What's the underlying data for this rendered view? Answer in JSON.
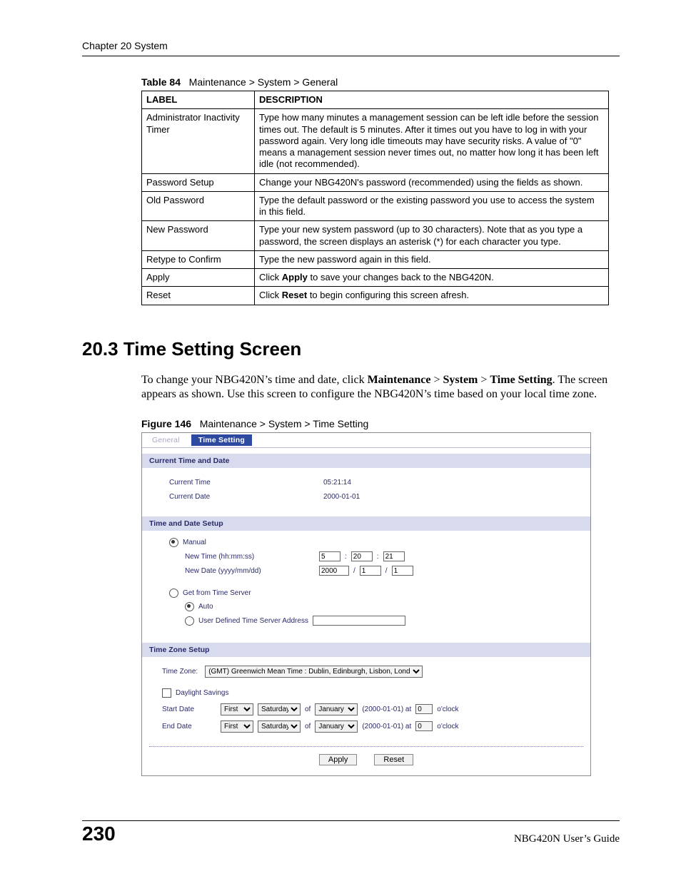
{
  "header": {
    "chapter": "Chapter 20 System"
  },
  "table": {
    "caption_num": "Table 84",
    "caption_text": "Maintenance > System > General",
    "col1": "LABEL",
    "col2": "DESCRIPTION",
    "rows": [
      {
        "label": "Administrator Inactivity Timer",
        "desc": "Type how many minutes a management session can be left idle before the session times out. The default is 5 minutes. After it times out you have to log in with your password again. Very long idle timeouts may have security risks. A value of \"0\" means a management session never times out, no matter how long it has been left idle (not recommended)."
      },
      {
        "label": "Password Setup",
        "desc": "Change your NBG420N's password (recommended) using the fields as shown."
      },
      {
        "label": "Old Password",
        "desc": "Type the default password or the existing password you use to access the system in this field."
      },
      {
        "label": "New Password",
        "desc": "Type your new system password (up to 30 characters). Note that as you type a password, the screen displays an asterisk (*) for each character you type."
      },
      {
        "label": "Retype to Confirm",
        "desc": "Type the new password again in this field."
      },
      {
        "label": "Apply",
        "desc_pre": "Click ",
        "desc_bold": "Apply",
        "desc_post": " to save your changes back to the NBG420N."
      },
      {
        "label": "Reset",
        "desc_pre": "Click ",
        "desc_bold": "Reset",
        "desc_post": " to begin configuring this screen afresh."
      }
    ]
  },
  "section": {
    "heading": "20.3  Time Setting Screen",
    "p_pre": "To change your NBG420N’s time and date, click ",
    "p_b1": "Maintenance",
    "p_gt1": " > ",
    "p_b2": "System",
    "p_gt2": " > ",
    "p_b3": "Time Setting",
    "p_post": ". The screen appears as shown. Use this screen to configure the NBG420N’s time based on your local time zone."
  },
  "figure": {
    "caption_num": "Figure 146",
    "caption_text": "Maintenance > System > Time Setting",
    "tabs": {
      "general": "General",
      "time": "Time Setting"
    },
    "sec1_hdr": "Current Time and Date",
    "cur_time_lbl": "Current Time",
    "cur_time_val": "05:21:14",
    "cur_date_lbl": "Current Date",
    "cur_date_val": "2000-01-01",
    "sec2_hdr": "Time and Date Setup",
    "manual_lbl": "Manual",
    "new_time_lbl": "New Time (hh:mm:ss)",
    "nt_h": "5",
    "nt_m": "20",
    "nt_s": "21",
    "colon": ":",
    "new_date_lbl": "New Date (yyyy/mm/dd)",
    "nd_y": "2000",
    "nd_m": "1",
    "nd_d": "1",
    "slash": "/",
    "get_server_lbl": "Get from Time Server",
    "auto_lbl": "Auto",
    "userdef_lbl": "User Defined Time Server Address",
    "sec3_hdr": "Time Zone Setup",
    "tz_lbl": "Time Zone:",
    "tz_val": "(GMT) Greenwich Mean Time : Dublin, Edinburgh, Lisbon, London",
    "ds_lbl": "Daylight Savings",
    "start_lbl": "Start Date",
    "end_lbl": "End Date",
    "dd_first": "First",
    "dd_sat": "Saturday",
    "of": "of",
    "dd_jan": "January",
    "dateparen": "(2000-01-01)  at",
    "oclock": "o'clock",
    "hour0": "0",
    "btn_apply": "Apply",
    "btn_reset": "Reset"
  },
  "footer": {
    "page": "230",
    "guide": "NBG420N User’s Guide"
  }
}
